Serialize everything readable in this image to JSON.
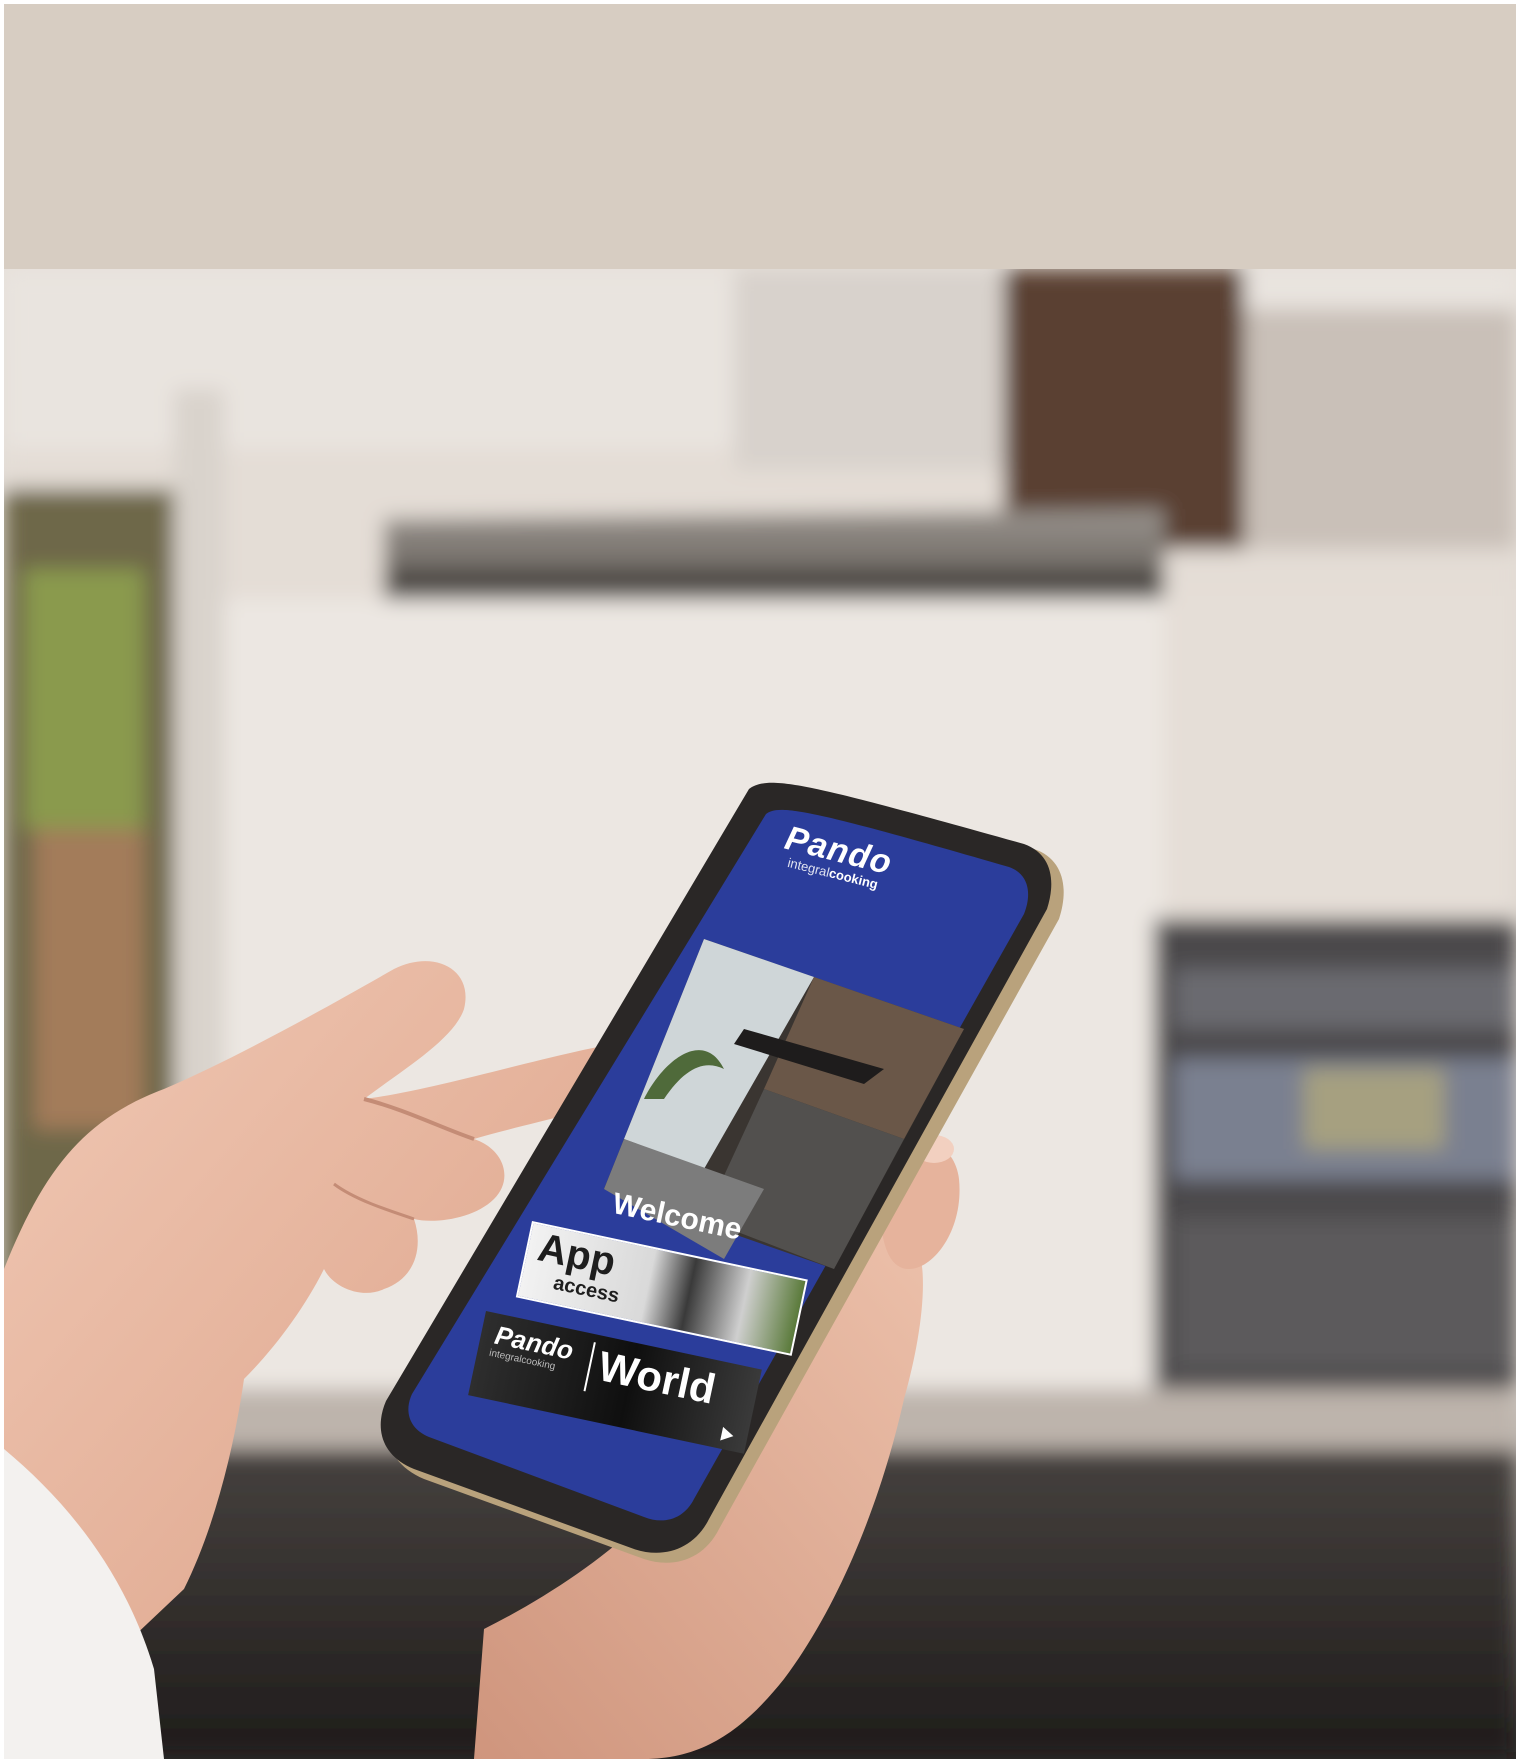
{
  "colors": {
    "top_band": "#d7cdc2",
    "screen_blue": "#2b3d9b",
    "phone_frame": "#2a2726",
    "skin": "#e8b9a3"
  },
  "app": {
    "brand": "Pando",
    "tagline_light": "integral",
    "tagline_bold": "cooking",
    "welcome": "Welcome",
    "app_access_big": "App",
    "app_access_small": "access",
    "world_brand": "Pando",
    "world_tagline": "integralcooking",
    "world_label": "World"
  },
  "icons": {
    "play": "play-triangle-icon"
  }
}
